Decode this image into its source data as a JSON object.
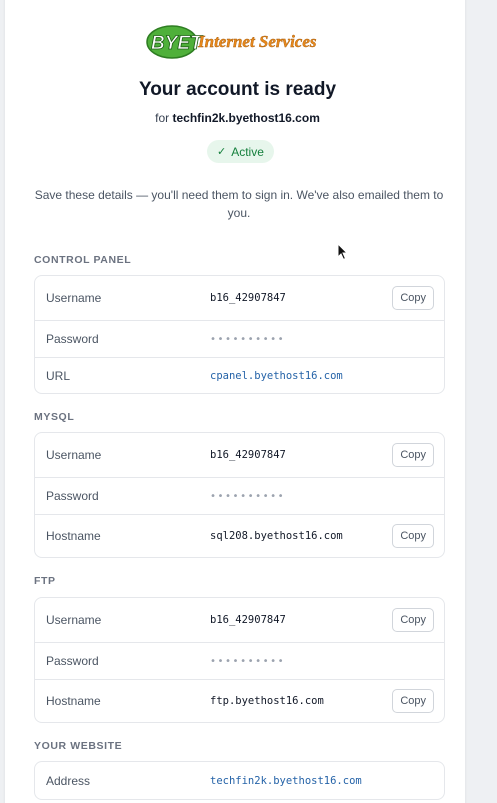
{
  "brand": {
    "logo_text_1": "BYET",
    "logo_text_2": "Internet Services"
  },
  "header": {
    "title": "Your account is ready",
    "subtitle_prefix": "for",
    "domain": "techfin2k.byethost16.com",
    "status": "Active"
  },
  "note": "Save these details — you'll need them to sign in. We've also emailed them to you.",
  "copy_label": "Copy",
  "control_panel": {
    "label": "CONTROL PANEL",
    "rows": [
      {
        "label": "Username",
        "value": "b16_42907847"
      },
      {
        "label": "Password",
        "value": "••••••••••"
      },
      {
        "label": "URL",
        "value": "cpanel.byethost16.com"
      }
    ]
  },
  "mysql": {
    "label": "MYSQL",
    "rows": [
      {
        "label": "Username",
        "value": "b16_42907847"
      },
      {
        "label": "Password",
        "value": "••••••••••"
      },
      {
        "label": "Hostname",
        "value": "sql208.byethost16.com"
      }
    ]
  },
  "ftp": {
    "label": "FTP",
    "rows": [
      {
        "label": "Username",
        "value": "b16_42907847"
      },
      {
        "label": "Password",
        "value": "••••••••••"
      },
      {
        "label": "Hostname",
        "value": "ftp.byethost16.com"
      }
    ]
  },
  "website": {
    "label": "YOUR WEBSITE",
    "rows": [
      {
        "label": "Address",
        "value": "techfin2k.byethost16.com"
      }
    ]
  },
  "colors": {
    "accent_link": "#2563a8",
    "status_green": "#15803d",
    "logo_orange": "#e8891c",
    "logo_green": "#3a9a2a"
  }
}
